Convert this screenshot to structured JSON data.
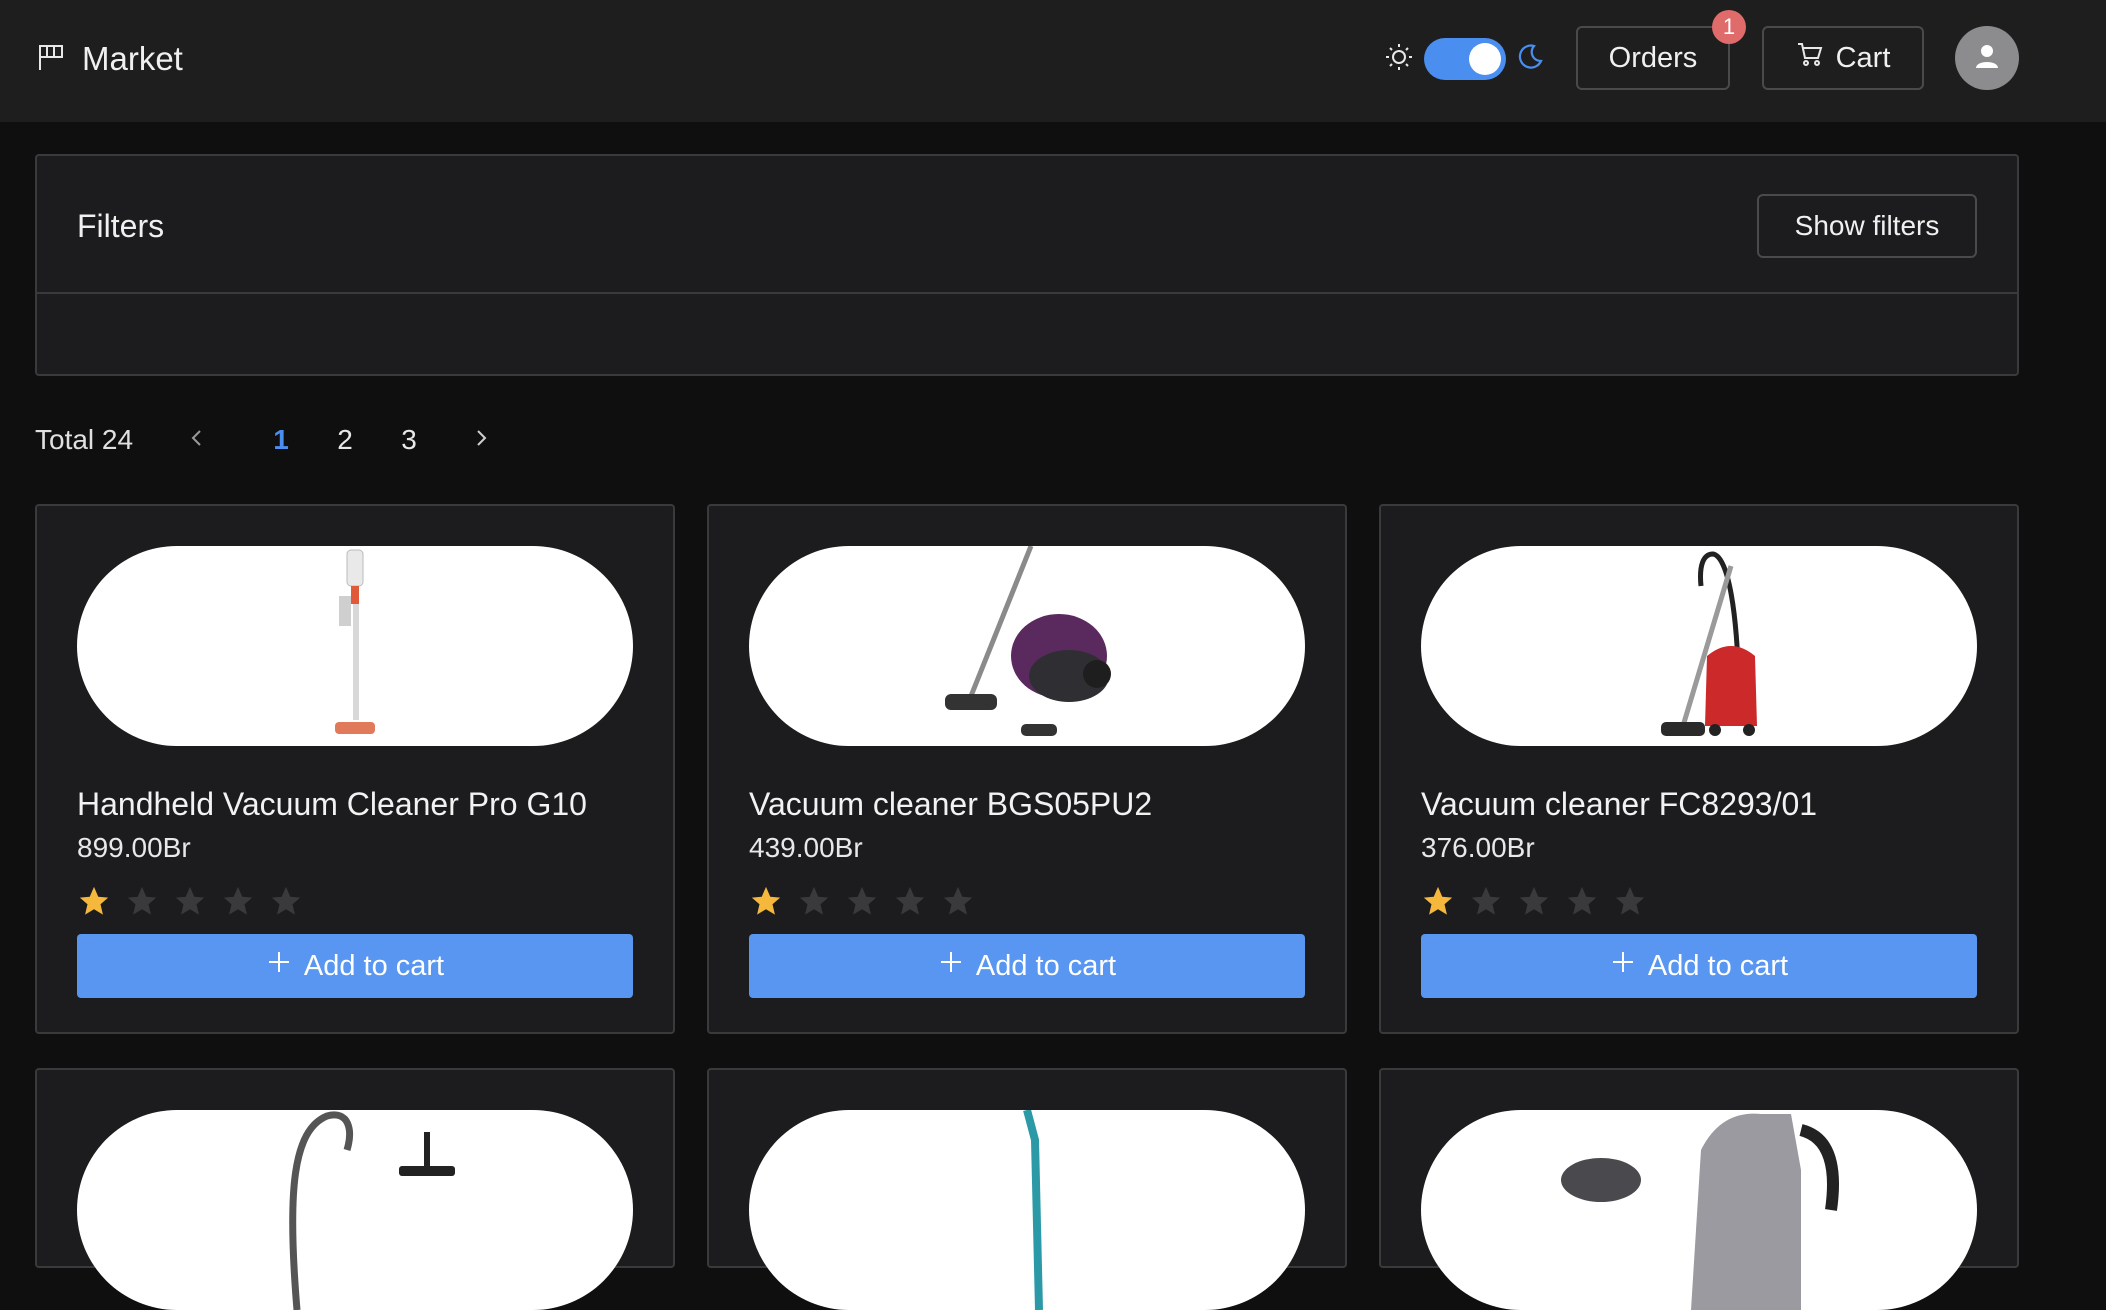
{
  "header": {
    "brand": "Market",
    "orders_label": "Orders",
    "orders_badge": "1",
    "cart_label": "Cart",
    "theme": "dark"
  },
  "filters": {
    "title": "Filters",
    "toggle_label": "Show filters"
  },
  "pagination": {
    "total_label": "Total 24",
    "pages": [
      "1",
      "2",
      "3"
    ],
    "current": "1"
  },
  "products": [
    {
      "name": "Handheld Vacuum Cleaner Pro G10",
      "price": "899.00Br",
      "rating": 1,
      "add_label": "Add to cart",
      "image": "stick-vacuum"
    },
    {
      "name": "Vacuum cleaner BGS05PU2",
      "price": "439.00Br",
      "rating": 1,
      "add_label": "Add to cart",
      "image": "canister-vacuum-purple"
    },
    {
      "name": "Vacuum cleaner FC8293/01",
      "price": "376.00Br",
      "rating": 1,
      "add_label": "Add to cart",
      "image": "canister-vacuum-red"
    },
    {
      "image": "vacuum-hose"
    },
    {
      "image": "upright-vacuum-teal"
    },
    {
      "image": "electric-kettle"
    }
  ],
  "colors": {
    "accent": "#5896f1",
    "star_filled": "#f5b83d",
    "star_empty": "#3a3a3d",
    "badge": "#e06b6b"
  }
}
